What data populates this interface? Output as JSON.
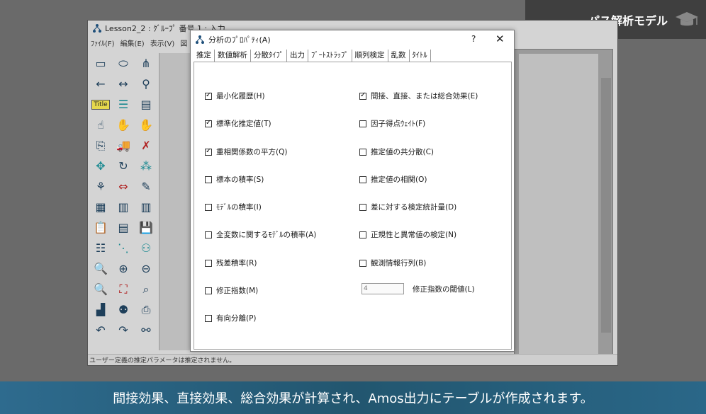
{
  "course_badge": {
    "title": "パス解析モデル",
    "icon": "graduation-cap-icon"
  },
  "amos": {
    "title": "Lesson2_2 : ｸﾞﾙｰﾌﾟ 番号 1 : 入力",
    "menu": [
      "ﾌｧｲﾙ(F)",
      "編集(E)",
      "表示(V)",
      "図"
    ],
    "status": "ユーザー定義の推定パラメータは推定されません。",
    "title_tool_label": "Title"
  },
  "dialog": {
    "title": "分析のﾌﾟﾛﾊﾟﾃｨ(A)",
    "help": "?",
    "close": "✕",
    "tabs": [
      "推定",
      "数値解析",
      "分散ﾀｲﾌﾟ",
      "出力",
      "ﾌﾞｰﾄｽﾄﾗｯﾌﾟ",
      "順列検定",
      "乱数",
      "ﾀｲﾄﾙ"
    ],
    "active_tab": "出力",
    "left_options": [
      {
        "label": "最小化履歴(H)",
        "checked": true
      },
      {
        "label": "標準化推定値(T)",
        "checked": true
      },
      {
        "label": "重相関係数の平方(Q)",
        "checked": true
      },
      {
        "label": "標本の積率(S)",
        "checked": false
      },
      {
        "label": "ﾓﾃﾞﾙの積率(I)",
        "checked": false
      },
      {
        "label": "全変数に関するﾓﾃﾞﾙの積率(A)",
        "checked": false
      },
      {
        "label": "残差積率(R)",
        "checked": false
      },
      {
        "label": "修正指数(M)",
        "checked": false
      },
      {
        "label": "有向分離(P)",
        "checked": false
      }
    ],
    "right_options": [
      {
        "label": "間接、直接、または総合効果(E)",
        "checked": true
      },
      {
        "label": "因子得点ｳｪｲﾄ(F)",
        "checked": false
      },
      {
        "label": "推定値の共分散(C)",
        "checked": false
      },
      {
        "label": "推定値の相関(O)",
        "checked": false
      },
      {
        "label": "差に対する検定統計量(D)",
        "checked": false
      },
      {
        "label": "正規性と異常値の検定(N)",
        "checked": false
      },
      {
        "label": "観測情報行列(B)",
        "checked": false
      }
    ],
    "threshold": {
      "value": "4",
      "label": "修正指数の閾値(L)"
    }
  },
  "caption": "間接効果、直接効果、総合効果が計算され、Amos出力にテーブルが作成されます。"
}
